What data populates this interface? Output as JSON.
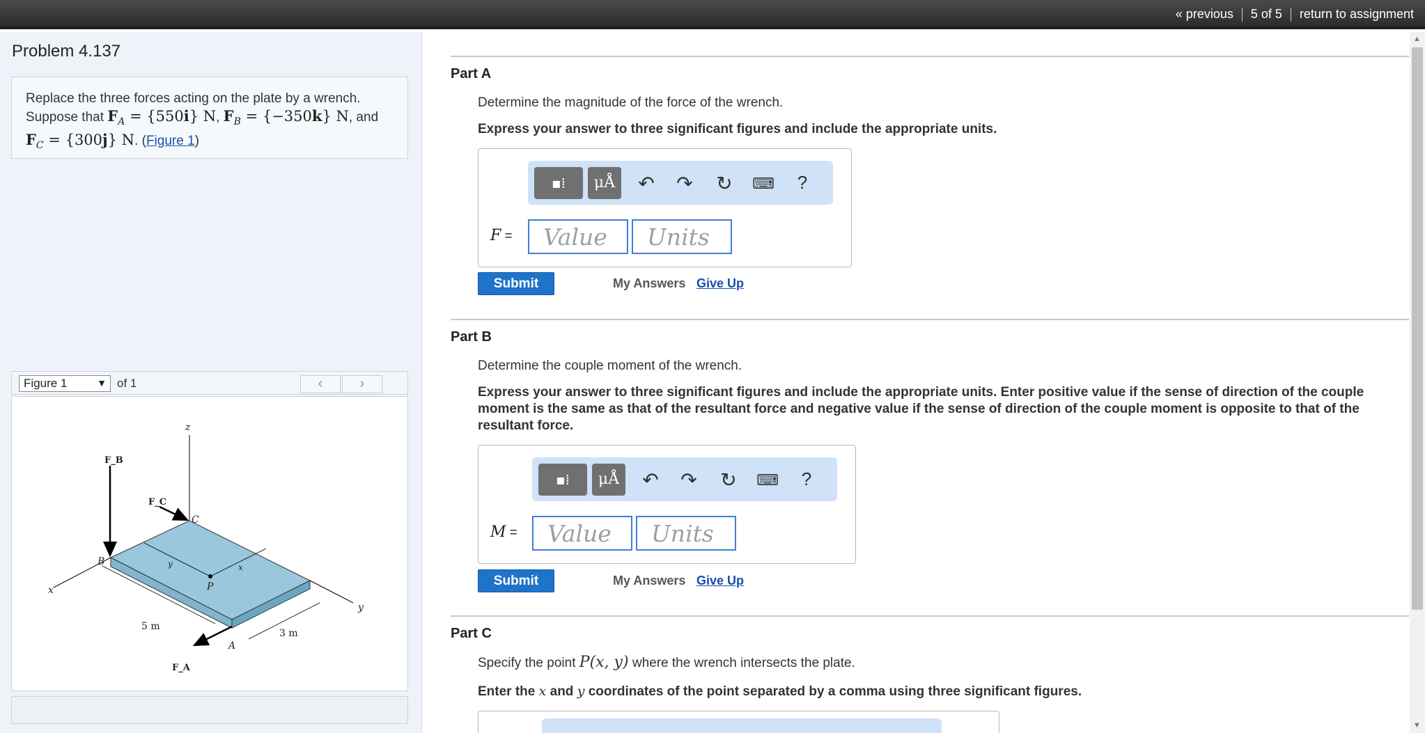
{
  "topnav": {
    "previous": "« previous",
    "position": "5 of 5",
    "return": "return to assignment"
  },
  "problem": {
    "title": "Problem 4.137",
    "line1": "Replace the three forces acting on the plate by a wrench.",
    "line2_pre": "Suppose that ",
    "fa": "F_A = {550i} N",
    "fb": "F_B = {−350k} N",
    "and": ", and",
    "fc": "F_C = {300j} N",
    "figure_link": "Figure 1"
  },
  "figure": {
    "select_value": "Figure 1",
    "of": "of 1",
    "labels": {
      "z": "z",
      "x": "x",
      "y": "y",
      "fb": "F_B",
      "fc": "F_C",
      "fa": "F_A",
      "c": "C",
      "b": "B",
      "a": "A",
      "p": "P",
      "dim5": "5 m",
      "dim3": "3 m",
      "ylab": "y",
      "xlab": "x"
    }
  },
  "parts": [
    {
      "title": "Part A",
      "question": "Determine the magnitude of the force of the wrench.",
      "instruction": "Express your answer to three significant figures and include the appropriate units.",
      "var": "F",
      "value_placeholder": "Value",
      "units_placeholder": "Units",
      "submit": "Submit",
      "my_answers": "My Answers",
      "give_up": "Give Up"
    },
    {
      "title": "Part B",
      "question": "Determine the couple moment of the wrench.",
      "instruction": "Express your answer to three significant figures and include the appropriate units. Enter positive value if the sense of direction of the couple moment is the same as that of the resultant force and negative value if the sense of direction of the couple moment is opposite to that of the resultant force.",
      "var": "M",
      "value_placeholder": "Value",
      "units_placeholder": "Units",
      "submit": "Submit",
      "my_answers": "My Answers",
      "give_up": "Give Up"
    },
    {
      "title": "Part C",
      "question_pre": "Specify the point ",
      "question_math": "P(x, y)",
      "question_post": " where the wrench intersects the plate.",
      "instruction_pre": "Enter the ",
      "instruction_x": "x",
      "instruction_mid": " and ",
      "instruction_y": "y",
      "instruction_post": " coordinates of the point separated by a comma using three significant figures."
    }
  ],
  "toolbar": {
    "templates_icon": "templates-icon",
    "units_label": "μÅ",
    "undo_icon": "undo-icon",
    "redo_icon": "redo-icon",
    "reset_icon": "reset-icon",
    "keyboard_icon": "keyboard-icon",
    "help": "?"
  },
  "colors": {
    "accent": "#1f74c9",
    "toolbar_bg": "#cfe2f7",
    "left_bg": "#eef3f9",
    "plate": "#9ac7dc"
  }
}
